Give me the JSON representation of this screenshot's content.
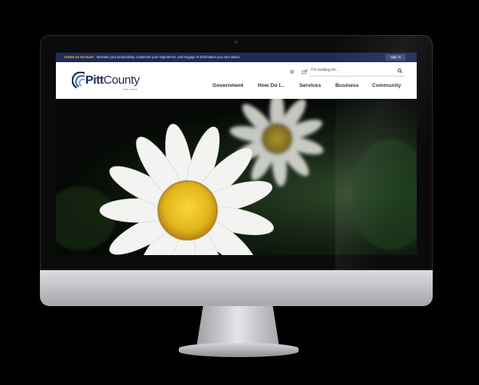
{
  "topbar": {
    "create_account": "Create an Account",
    "message": " - Increase your productivity, customize your experience, and engage in information you care about.",
    "sign_in": "Sign in"
  },
  "header": {
    "logo_word_1": "Pitt",
    "logo_word_2": "County",
    "logo_sub": "North Carolina",
    "search_placeholder": "I'm looking for..."
  },
  "nav": {
    "items": [
      "Government",
      "How Do I...",
      "Services",
      "Business",
      "Community"
    ]
  },
  "icons": {
    "settings": "gear-icon",
    "share": "share-icon",
    "search": "search-icon"
  },
  "colors": {
    "topbar": "#1e2b55",
    "accent": "#f2c23a",
    "logo_blue": "#1f2a55"
  }
}
